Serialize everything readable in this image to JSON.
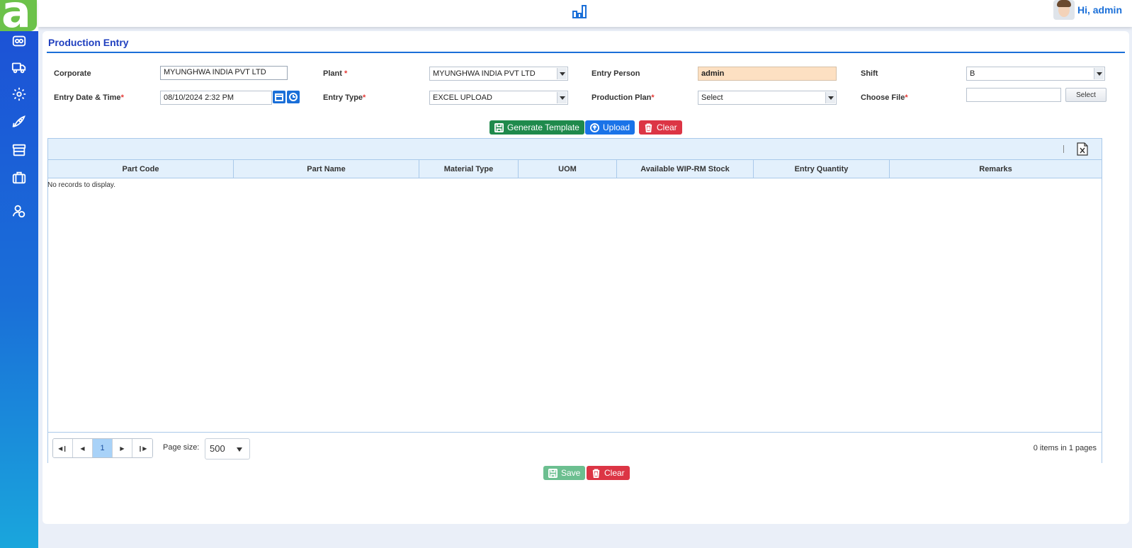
{
  "app": {
    "logo_letter": "a",
    "greeting": "Hi, admin"
  },
  "sidebar": {
    "icons": [
      "dashboard-icon",
      "truck-icon",
      "gear-icon",
      "rocket-icon",
      "store-icon",
      "briefcase-icon",
      "users-icon"
    ]
  },
  "page": {
    "title": "Production Entry"
  },
  "form": {
    "corporate": {
      "label": "Corporate",
      "value": "MYUNGHWA INDIA PVT LTD"
    },
    "plant": {
      "label": "Plant",
      "required": "*",
      "value": "MYUNGHWA INDIA PVT LTD"
    },
    "entry_person": {
      "label": "Entry Person",
      "value": "admin"
    },
    "shift": {
      "label": "Shift",
      "value": "B"
    },
    "entry_datetime": {
      "label": "Entry Date & Time",
      "required": "*",
      "value": "08/10/2024 2:32 PM"
    },
    "entry_type": {
      "label": "Entry Type",
      "required": "*",
      "value": "EXCEL UPLOAD"
    },
    "production_plan": {
      "label": "Production Plan",
      "required": "*",
      "value": "Select"
    },
    "choose_file": {
      "label": "Choose File",
      "required": "*",
      "value": "",
      "button": "Select"
    }
  },
  "actions": {
    "generate_template": "Generate Template",
    "upload": "Upload",
    "clear": "Clear"
  },
  "grid": {
    "columns": [
      "Part Code",
      "Part Name",
      "Material Type",
      "UOM",
      "Available WIP-RM Stock",
      "Entry Quantity",
      "Remarks"
    ],
    "empty_message": "No records to display.",
    "pager": {
      "current_page": "1",
      "page_size_label": "Page size:",
      "page_size": "500",
      "info": "0 items in 1 pages"
    }
  },
  "footer": {
    "save": "Save",
    "clear": "Clear"
  },
  "colors": {
    "accent": "#1a6fd8",
    "green": "#1f8a4c",
    "red": "#dc3545",
    "highlight": "#fde0c2",
    "logo_green": "#6cc24a"
  }
}
